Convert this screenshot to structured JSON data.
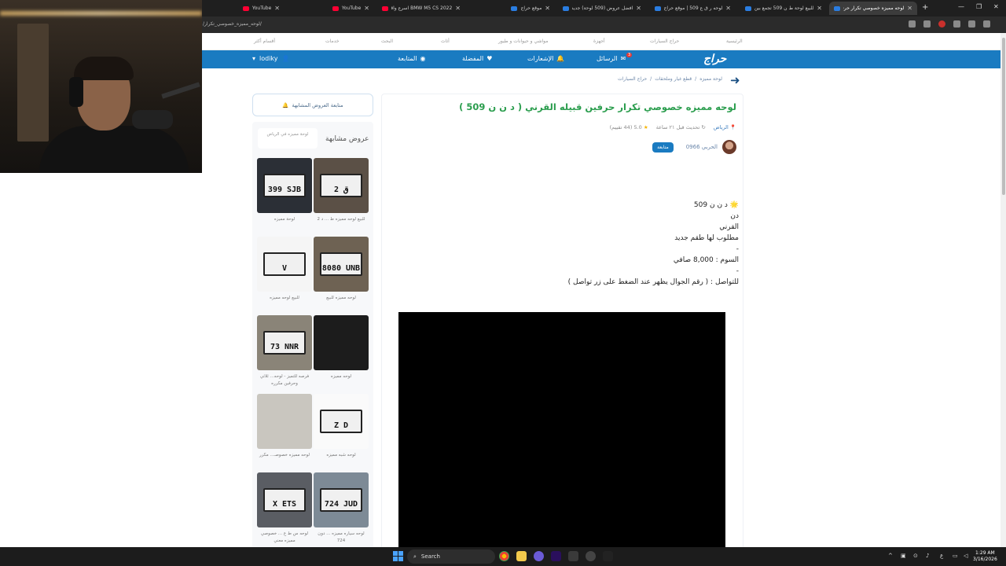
{
  "browser": {
    "tabs": [
      {
        "title": "YouTube",
        "icon": "youtube-icon"
      },
      {
        "title": "YouTube",
        "icon": "youtube-icon"
      },
      {
        "title": "BMW M5 CS 2022 اسرع واقوى",
        "icon": "youtube-icon"
      },
      {
        "title": "موقع حراج",
        "icon": "haraj-icon"
      },
      {
        "title": "افضل عروض (509 لوحة) جديد ...",
        "icon": "haraj-icon"
      },
      {
        "title": "لوحه ر ق ع 509 | موقع حراج",
        "icon": "haraj-icon"
      },
      {
        "title": "للبيع لوحة ط ن 509 تجمع بين",
        "icon": "haraj-icon"
      },
      {
        "title": "لوحه مميزه خصوصي تكرار حرف...",
        "icon": "haraj-icon"
      }
    ],
    "url": "/لوحه_مميزه_خصوصي_تكرار/"
  },
  "topnav": {
    "items": [
      "الرئيسية",
      "حراج السيارات",
      "أجهزة",
      "مواشي و حيوانات و طيور",
      "أثاث",
      "البحث",
      "خدمات",
      "أقسام أكثر"
    ]
  },
  "header": {
    "logo": "حراج",
    "messages": "الرسائل",
    "messages_count": "3",
    "notifications": "الإشعارات",
    "favorites": "المفضلة",
    "following": "المتابعة",
    "username": "lodiky"
  },
  "breadcrumb": [
    "لوحة مميزه",
    "قطع غيار وملحقات",
    "حراج السيارات"
  ],
  "post": {
    "title": "لوحه مميزه خصوصي تكرار حرفين قبيله القرني ( د ن ن 509 )",
    "location": "الرياض",
    "updated": "تحديث قبل ٢١ ساعة",
    "rating": "5.0",
    "rating_count": "(44 تقييم)",
    "seller": "الحربي 0966",
    "follow": "متابعة",
    "body": [
      "🌟 د ن ن 509",
      "دن",
      "القرني",
      "مطلوب لها طقم جديد",
      "-",
      "السوم : 8,000 صافي",
      "-",
      "للتواصل : ( رقم الجوال يظهر عند الضغط على زر تواصل )"
    ]
  },
  "sidebar": {
    "follow_similar": "متابعة العروض المشابهة",
    "similar_title": "عروض مشابهة",
    "similar_chip": "لوحة مميزه في الرياض",
    "items": [
      {
        "plate": "399 SJB",
        "caption": "لوحة مميزه"
      },
      {
        "plate": "2 ق",
        "caption": "للبيع لوحه مميزه ط ... د 2"
      },
      {
        "plate": "V",
        "caption": "للبيع لوحه مميزه"
      },
      {
        "plate": "8080 UNB",
        "caption": "لوحه مميزه للبيع"
      },
      {
        "plate": "73 NNR",
        "caption": "فرصه للتميز - لوحه... ثلاثي وحرفين مكرره"
      },
      {
        "plate": "",
        "caption": "لوحه مميزه"
      },
      {
        "plate": "",
        "caption": "لوحه مميزه خصوصـ... مكرر"
      },
      {
        "plate": "Z D",
        "caption": "لوحه شبه مميزه"
      },
      {
        "plate": "X ETS",
        "caption": "لوحه س ط ع ... خصوصي مميزه معني"
      },
      {
        "plate": "724 JUD",
        "caption": "لوحه سياره مميزه ... دون 724"
      }
    ]
  },
  "taskbar": {
    "search": "Search",
    "time": "1:29 AM",
    "date": "3/16/2026"
  }
}
